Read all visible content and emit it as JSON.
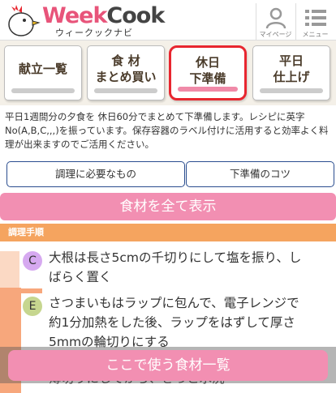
{
  "header": {
    "logo_main_week": "Week",
    "logo_main_cook": "Cook",
    "logo_sub": "ウィークックナビ",
    "mypage_label": "マイページ",
    "menu_label": "メニュー"
  },
  "tabs": [
    {
      "label": "献立一覧",
      "active": false
    },
    {
      "label": "食 材\nまとめ買い",
      "active": false
    },
    {
      "label": "休日\n下準備",
      "active": true
    },
    {
      "label": "平日\n仕上げ",
      "active": false
    }
  ],
  "description": "平日1週間分の夕食を 休日60分でまとめて下準備します。レシピに英字No(A,B,C,,,)を振っています。保存容器のラベル付けに活用すると効率よく料理が出来ますのでご活用ください。",
  "buttons": {
    "needs": "調理に必要なもの",
    "tips": "下準備のコツ",
    "show_all": "食材を全て表示"
  },
  "section": {
    "title": "調理手順"
  },
  "steps": [
    {
      "letter": "C",
      "text": "大根は長さ5cmの千切りにして塩を振り、しばらく置く"
    },
    {
      "letter": "E",
      "text": "さつまいもはラップに包んで、電子レンジで約1分加熱をした後、ラップをはずして厚さ5mmの輪切りにする"
    },
    {
      "letter": "",
      "text": "薄切りにしてから、さっと水洗"
    }
  ],
  "floating": {
    "label": "ここで使う食材一覧"
  },
  "colors": {
    "brand_pink": "#f28fb2",
    "active_border": "#e8262f",
    "section_orange": "#f5a45f"
  }
}
